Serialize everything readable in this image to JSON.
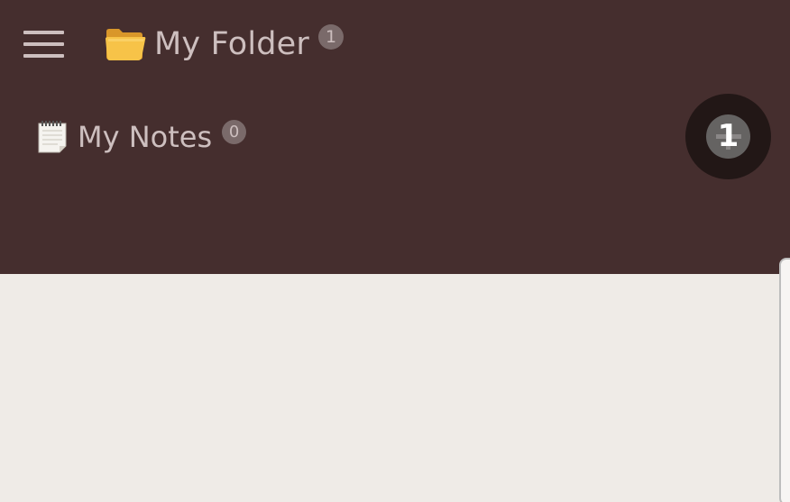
{
  "header": {
    "title": "My Folder",
    "title_badge": "1",
    "menu_icon": "hamburger-menu-icon",
    "folder_icon": "folder-icon"
  },
  "notes": {
    "label": "My Notes",
    "badge": "0",
    "icon": "notepad-icon"
  },
  "fab": {
    "icon": "plus-icon",
    "step_marker": "1"
  },
  "colors": {
    "header_bg": "#452e2e",
    "content_bg": "#efebe7",
    "text": "#cdbfbf",
    "fab_bg": "#221716"
  }
}
